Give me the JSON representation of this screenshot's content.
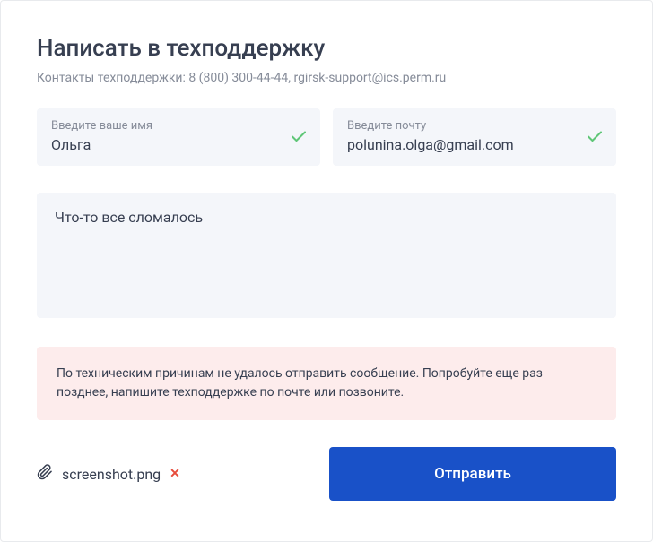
{
  "title": "Написать в техподдержку",
  "subtitle": "Контакты техподдержки: 8 (800) 300-44-44, rgirsk-support@ics.perm.ru",
  "name_field": {
    "label": "Введите ваше имя",
    "value": "Ольга"
  },
  "email_field": {
    "label": "Введите почту",
    "value": "polunina.olga@gmail.com"
  },
  "message_field": {
    "value": "Что-то все сломалось"
  },
  "error_message": "По техническим причинам не удалось отправить сообщение. Попробуйте еще раз позднее, напишите техподдержке по почте или позвоните.",
  "attachment": {
    "filename": "screenshot.png"
  },
  "submit_label": "Отправить"
}
